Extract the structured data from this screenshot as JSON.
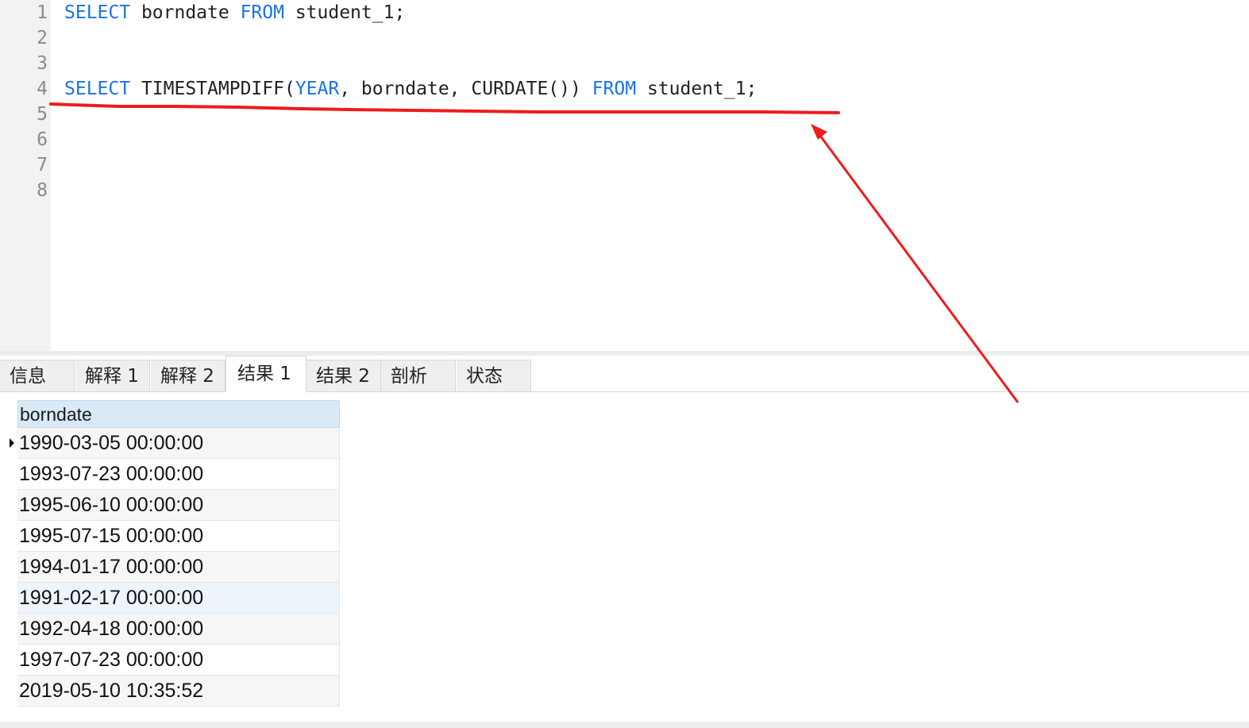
{
  "editor": {
    "lines": [
      {
        "num": "1",
        "tokens": [
          {
            "t": "SELECT",
            "kw": true
          },
          {
            "t": " borndate ",
            "kw": false
          },
          {
            "t": "FROM",
            "kw": true
          },
          {
            "t": " student_1;",
            "kw": false
          }
        ]
      },
      {
        "num": "2",
        "tokens": []
      },
      {
        "num": "3",
        "tokens": []
      },
      {
        "num": "4",
        "tokens": [
          {
            "t": "SELECT",
            "kw": true
          },
          {
            "t": " TIMESTAMPDIFF(",
            "kw": false
          },
          {
            "t": "YEAR",
            "kw": true
          },
          {
            "t": ", borndate, CURDATE()) ",
            "kw": false
          },
          {
            "t": "FROM",
            "kw": true
          },
          {
            "t": " student_1;",
            "kw": false
          }
        ]
      },
      {
        "num": "5",
        "tokens": []
      },
      {
        "num": "6",
        "tokens": []
      },
      {
        "num": "7",
        "tokens": []
      },
      {
        "num": "8",
        "tokens": []
      }
    ]
  },
  "tabs": [
    {
      "label": "信息",
      "active": false
    },
    {
      "label": "解释 1",
      "active": false
    },
    {
      "label": "解释 2",
      "active": false
    },
    {
      "label": "结果 1",
      "active": true
    },
    {
      "label": "结果 2",
      "active": false
    },
    {
      "label": "剖析",
      "active": false
    },
    {
      "label": "状态",
      "active": false
    }
  ],
  "results": {
    "column": "borndate",
    "rows": [
      "1990-03-05 00:00:00",
      "1993-07-23 00:00:00",
      "1995-06-10 00:00:00",
      "1995-07-15 00:00:00",
      "1994-01-17 00:00:00",
      "1991-02-17 00:00:00",
      "1992-04-18 00:00:00",
      "1997-07-23 00:00:00",
      "2019-05-10 10:35:52"
    ],
    "current_row_index": 0
  },
  "colors": {
    "keyword": "#1a73e8",
    "annotation": "#ee1c1c",
    "header_bg": "#d9e9f7"
  }
}
